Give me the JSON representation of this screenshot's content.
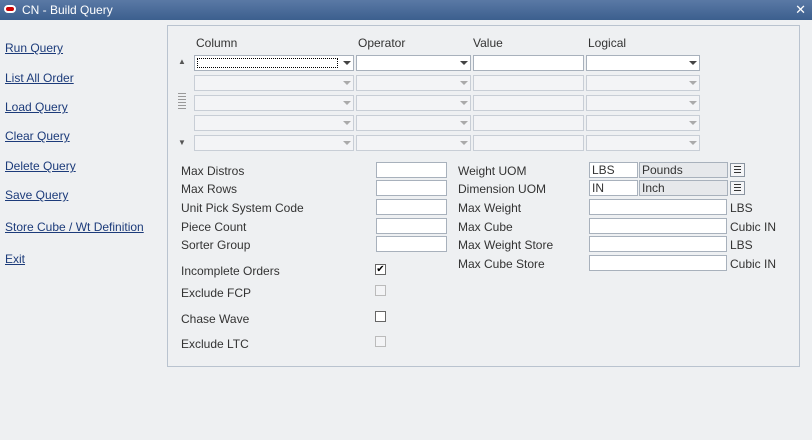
{
  "window": {
    "title": "CN - Build Query"
  },
  "nav": {
    "run_query": "Run Query",
    "list_all_order": "List All Order",
    "load_query": "Load Query",
    "clear_query": "Clear Query",
    "delete_query": "Delete Query",
    "save_query": "Save Query",
    "store_cube": "Store Cube / Wt Definition",
    "exit": "Exit"
  },
  "grid": {
    "headers": {
      "column": "Column",
      "operator": "Operator",
      "value": "Value",
      "logical": "Logical"
    }
  },
  "fields": {
    "max_distros": "Max Distros",
    "max_rows": "Max Rows",
    "unit_pick_system_code": "Unit Pick System Code",
    "piece_count": "Piece Count",
    "sorter_group": "Sorter Group",
    "weight_uom": "Weight UOM",
    "weight_uom_code": "LBS",
    "weight_uom_desc": "Pounds",
    "dimension_uom": "Dimension UOM",
    "dimension_uom_code": "IN",
    "dimension_uom_desc": "Inch",
    "max_weight": "Max Weight",
    "max_weight_unit": "LBS",
    "max_cube": "Max Cube",
    "max_cube_unit": "Cubic IN",
    "max_weight_store": "Max Weight Store",
    "max_weight_store_unit": "LBS",
    "max_cube_store": "Max Cube Store",
    "max_cube_store_unit": "Cubic IN"
  },
  "checks": {
    "incomplete_orders": "Incomplete Orders",
    "incomplete_orders_mark": "✔",
    "exclude_fcp": "Exclude FCP",
    "chase_wave": "Chase Wave",
    "exclude_ltc": "Exclude LTC"
  }
}
